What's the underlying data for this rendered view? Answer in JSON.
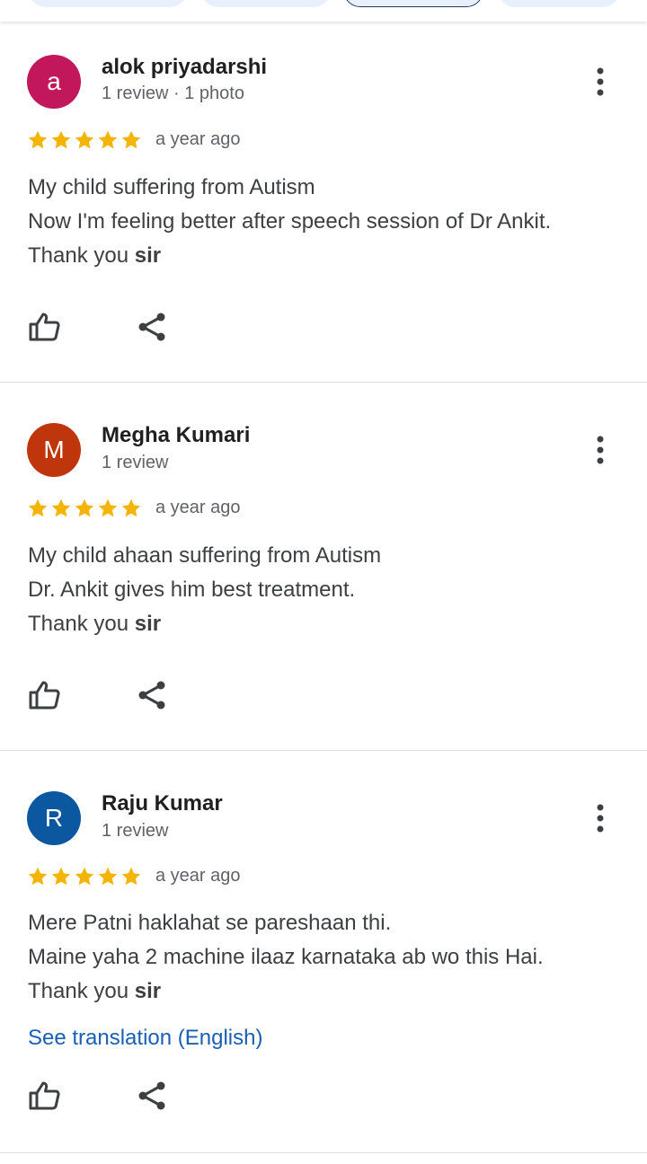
{
  "reviews": [
    {
      "avatar_letter": "a",
      "avatar_color": "#c2185b",
      "name": "alok priyadarshi",
      "meta": "1 review · 1 photo",
      "rating": 5,
      "time": "a year ago",
      "lines": [
        "My child suffering from Autism",
        "Now I'm feeling better after speech session of Dr Ankit."
      ],
      "closing_prefix": "Thank you ",
      "closing_bold": "sir"
    },
    {
      "avatar_letter": "M",
      "avatar_color": "#bf360c",
      "name": "Megha Kumari",
      "meta": "1 review",
      "rating": 5,
      "time": "a year ago",
      "lines": [
        "My child ahaan suffering from Autism",
        "Dr. Ankit gives him best treatment."
      ],
      "closing_prefix": "Thank you ",
      "closing_bold": "sir"
    },
    {
      "avatar_letter": "R",
      "avatar_color": "#0b57a0",
      "name": "Raju Kumar",
      "meta": "1 review",
      "rating": 5,
      "time": "a year ago",
      "lines": [
        "Mere Patni haklahat se pareshaan thi.",
        "Maine yaha 2 machine ilaaz karnataka ab wo this Hai."
      ],
      "closing_prefix": "Thank you ",
      "closing_bold": "sir",
      "translation_link": "See translation (English)"
    }
  ],
  "icons": {
    "star": "star-icon",
    "more": "more-vert-icon",
    "like": "thumb-up-icon",
    "share": "share-icon"
  },
  "colors": {
    "star": "#f4b400",
    "link": "#1a5fb4",
    "divider": "#dadce0"
  }
}
